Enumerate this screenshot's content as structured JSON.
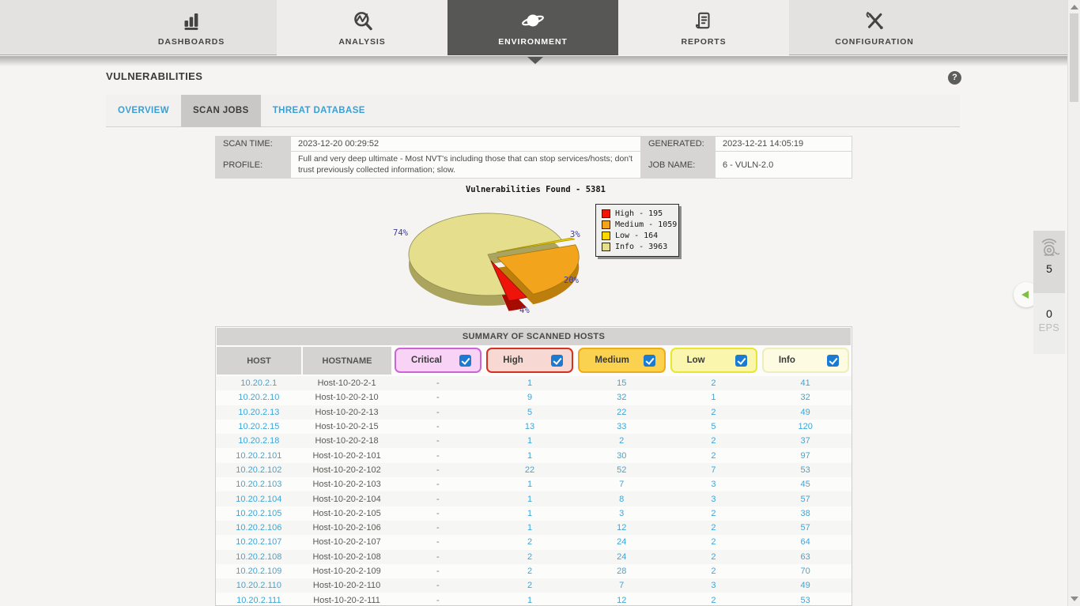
{
  "nav": {
    "items": [
      {
        "label": "DASHBOARDS",
        "icon": "bar-chart-icon",
        "active": false
      },
      {
        "label": "ANALYSIS",
        "icon": "magnifier-chart-icon",
        "active": false
      },
      {
        "label": "ENVIRONMENT",
        "icon": "saturn-icon",
        "active": true
      },
      {
        "label": "REPORTS",
        "icon": "report-document-icon",
        "active": false
      },
      {
        "label": "CONFIGURATION",
        "icon": "crossed-tools-icon",
        "active": false
      }
    ]
  },
  "page": {
    "title": "VULNERABILITIES",
    "help": "?"
  },
  "tabs": [
    {
      "label": "OVERVIEW",
      "active": false
    },
    {
      "label": "SCAN JOBS",
      "active": true
    },
    {
      "label": "THREAT DATABASE",
      "active": false
    }
  ],
  "scan_info": {
    "scan_time_label": "SCAN TIME:",
    "scan_time": "2023-12-20 00:29:52",
    "generated_label": "GENERATED:",
    "generated": "2023-12-21 14:05:19",
    "profile_label": "PROFILE:",
    "profile": "Full and very deep ultimate - Most NVT's including those that can stop services/hosts; don't trust previously collected information; slow.",
    "job_name_label": "JOB NAME:",
    "job_name": "6 - VULN-2.0"
  },
  "chart_data": {
    "type": "pie",
    "title": "Vulnerabilities Found - 5381",
    "total": 5381,
    "legend_position": "right",
    "slices": [
      {
        "label": "High",
        "value": 195,
        "percent": "4%",
        "color": "#ee1409"
      },
      {
        "label": "Medium",
        "value": 1059,
        "percent": "20%",
        "color": "#f2a51c"
      },
      {
        "label": "Low",
        "value": 164,
        "percent": "3%",
        "color": "#ffd800"
      },
      {
        "label": "Info",
        "value": 3963,
        "percent": "74%",
        "color": "#e5df8d"
      }
    ],
    "legend_items": [
      "High - 195",
      "Medium - 1059",
      "Low - 164",
      "Info - 3963"
    ]
  },
  "hosts_table": {
    "title": "SUMMARY OF SCANNED HOSTS",
    "host_header": "HOST",
    "hostname_header": "HOSTNAME",
    "filters": [
      {
        "label": "Critical",
        "checked": true,
        "bg": "#f8d3f6",
        "border": "#cd64d6"
      },
      {
        "label": "High",
        "checked": true,
        "bg": "#f8d8d3",
        "border": "#d8301f"
      },
      {
        "label": "Medium",
        "checked": true,
        "bg": "#fad24f",
        "border": "#efab18"
      },
      {
        "label": "Low",
        "checked": true,
        "bg": "#faf6ae",
        "border": "#e9e630"
      },
      {
        "label": "Info",
        "checked": true,
        "bg": "#fdfbe2",
        "border": "#efedbb"
      }
    ],
    "rows": [
      [
        "10.20.2.1",
        "Host-10-20-2-1",
        "-",
        "1",
        "15",
        "2",
        "41"
      ],
      [
        "10.20.2.10",
        "Host-10-20-2-10",
        "-",
        "9",
        "32",
        "1",
        "32"
      ],
      [
        "10.20.2.13",
        "Host-10-20-2-13",
        "-",
        "5",
        "22",
        "2",
        "49"
      ],
      [
        "10.20.2.15",
        "Host-10-20-2-15",
        "-",
        "13",
        "33",
        "5",
        "120"
      ],
      [
        "10.20.2.18",
        "Host-10-20-2-18",
        "-",
        "1",
        "2",
        "2",
        "37"
      ],
      [
        "10.20.2.101",
        "Host-10-20-2-101",
        "-",
        "1",
        "30",
        "2",
        "97"
      ],
      [
        "10.20.2.102",
        "Host-10-20-2-102",
        "-",
        "22",
        "52",
        "7",
        "53"
      ],
      [
        "10.20.2.103",
        "Host-10-20-2-103",
        "-",
        "1",
        "7",
        "3",
        "45"
      ],
      [
        "10.20.2.104",
        "Host-10-20-2-104",
        "-",
        "1",
        "8",
        "3",
        "57"
      ],
      [
        "10.20.2.105",
        "Host-10-20-2-105",
        "-",
        "1",
        "3",
        "2",
        "38"
      ],
      [
        "10.20.2.106",
        "Host-10-20-2-106",
        "-",
        "1",
        "12",
        "2",
        "57"
      ],
      [
        "10.20.2.107",
        "Host-10-20-2-107",
        "-",
        "2",
        "24",
        "2",
        "64"
      ],
      [
        "10.20.2.108",
        "Host-10-20-2-108",
        "-",
        "2",
        "24",
        "2",
        "63"
      ],
      [
        "10.20.2.109",
        "Host-10-20-2-109",
        "-",
        "2",
        "28",
        "2",
        "70"
      ],
      [
        "10.20.2.110",
        "Host-10-20-2-110",
        "-",
        "2",
        "7",
        "3",
        "49"
      ],
      [
        "10.20.2.111",
        "Host-10-20-2-111",
        "-",
        "1",
        "12",
        "2",
        "53"
      ]
    ]
  },
  "side_widget": {
    "alarm_count": "5",
    "eps_value": "0",
    "eps_label": "EPS"
  }
}
